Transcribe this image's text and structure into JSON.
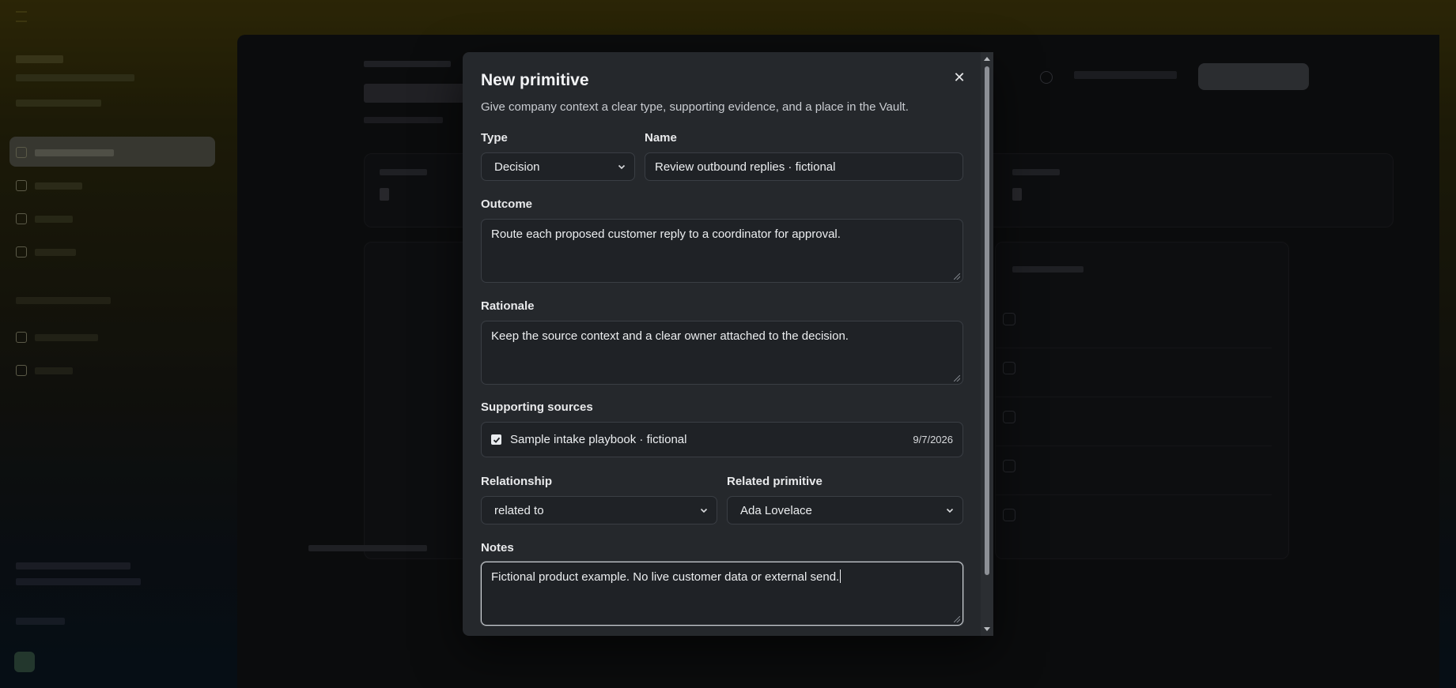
{
  "modal": {
    "title": "New primitive",
    "description": "Give company context a clear type, supporting evidence, and a place in the Vault.",
    "close_icon": "close-icon",
    "type": {
      "label": "Type",
      "value": "Decision"
    },
    "name": {
      "label": "Name",
      "value": "Review outbound replies · fictional"
    },
    "outcome": {
      "label": "Outcome",
      "value": "Route each proposed customer reply to a coordinator for approval."
    },
    "rationale": {
      "label": "Rationale",
      "value": "Keep the source context and a clear owner attached to the decision."
    },
    "supporting_sources": {
      "label": "Supporting sources",
      "items": [
        {
          "name": "Sample intake playbook · fictional",
          "date": "9/7/2026",
          "checked": true
        }
      ]
    },
    "relationship": {
      "label": "Relationship",
      "value": "related to"
    },
    "related_primitive": {
      "label": "Related primitive",
      "value": "Ada Lovelace"
    },
    "notes": {
      "label": "Notes",
      "value": "Fictional product example. No live customer data or external send."
    }
  },
  "colors": {
    "modal_bg": "#25282c",
    "field_bg": "#1f2226",
    "focus_border": "#cfd3d8"
  }
}
